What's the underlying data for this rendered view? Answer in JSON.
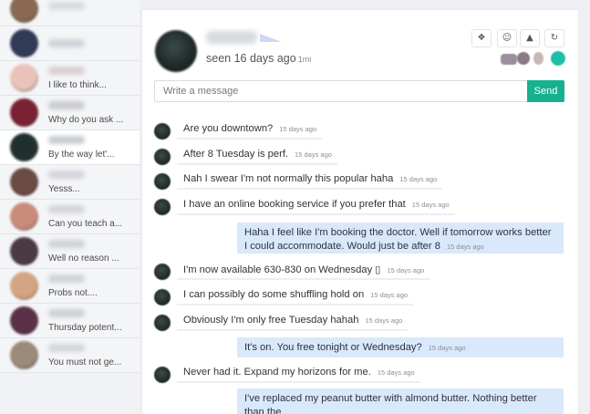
{
  "sidebar": {
    "items": [
      {
        "preview": "",
        "avatar": "#8a6a52",
        "name_tint": "#d8dadf"
      },
      {
        "preview": "",
        "avatar": "#2f3b57",
        "name_tint": "#cfd3d9"
      },
      {
        "preview": "I like to think...",
        "avatar": "#e9c3b9",
        "name_tint": "#d9cfd3"
      },
      {
        "preview": "Why do you ask ...",
        "avatar": "#7a2233",
        "name_tint": "#c9cbd1"
      },
      {
        "preview": "By the way let'...",
        "avatar": "#20302e",
        "name_tint": "#c9cdd2"
      },
      {
        "preview": "Yesss...",
        "avatar": "#6b4c43",
        "name_tint": "#d2d5da"
      },
      {
        "preview": "Can you teach a...",
        "avatar": "#c98c7a",
        "name_tint": "#d3d5da"
      },
      {
        "preview": "Well no reason ...",
        "avatar": "#4a3a44",
        "name_tint": "#cfd2d8"
      },
      {
        "preview": "Probs not....",
        "avatar": "#d4a582",
        "name_tint": "#cfd3d9"
      },
      {
        "preview": "Thursday potent...",
        "avatar": "#5a3148",
        "name_tint": "#cdd0d6"
      },
      {
        "preview": "You must not ge...",
        "avatar": "#9a8b7a",
        "name_tint": "#d3d6db"
      }
    ]
  },
  "header": {
    "seen_text": "seen 16 days ago",
    "seen_suffix": "1mi",
    "tools": [
      "share-icon",
      "emoji-icon",
      "warning-icon",
      "refresh-icon"
    ],
    "tool_glyphs": [
      "❖",
      "☺",
      "▲",
      "↻"
    ],
    "participant_colors": [
      "#9a8f9c",
      "#8a7a86",
      "#c7b8b4",
      "#1dbfa7"
    ]
  },
  "composer": {
    "placeholder": "Write a message",
    "send_label": "Send",
    "send_color": "#17b28d"
  },
  "messages": [
    {
      "dir": "in",
      "text": "Are you downtown?",
      "time": "15 days ago"
    },
    {
      "dir": "in",
      "text": "After 8 Tuesday is perf.",
      "time": "15 days ago"
    },
    {
      "dir": "in",
      "text": "Nah I swear I'm not normally this popular haha",
      "time": "15 days ago"
    },
    {
      "dir": "in",
      "text": "I have an online booking service if you prefer that",
      "time": "15 days ago"
    },
    {
      "dir": "out",
      "text": "Haha I feel like I'm booking the doctor. Well if tomorrow works better I could accommodate. Would just be after 8",
      "time": "15 days ago"
    },
    {
      "dir": "in",
      "text": "I'm now available 630-830 on Wednesday ▯",
      "time": "15 days ago"
    },
    {
      "dir": "in",
      "text": "I can possibly do some shuffling hold on",
      "time": "15 days ago"
    },
    {
      "dir": "in",
      "text": "Obviously I'm only free Tuesday hahah",
      "time": "15 days ago"
    },
    {
      "dir": "out",
      "text": "It's on. You free tonight or Wednesday?",
      "time": "15 days ago"
    },
    {
      "dir": "in",
      "text": "Never had it. Expand my horizons for me.",
      "time": "15 days ago"
    },
    {
      "dir": "out",
      "text": "I've replaced my peanut butter with almond butter. Nothing better than the",
      "time": ""
    }
  ]
}
